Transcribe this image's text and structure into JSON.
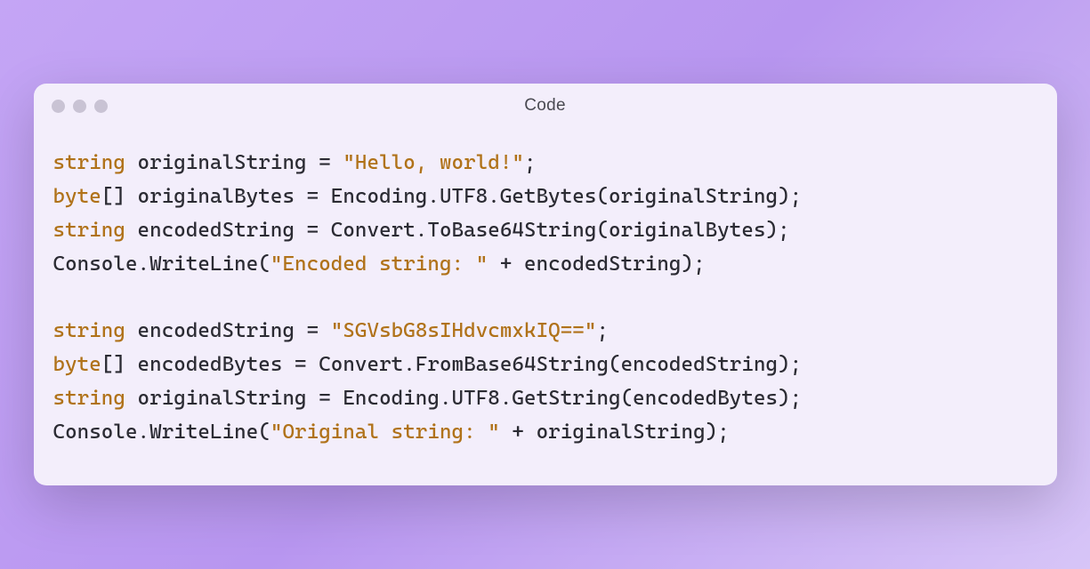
{
  "window": {
    "title": "Code"
  },
  "code": {
    "lines": [
      [
        {
          "cls": "tok-keyword",
          "text": "string"
        },
        {
          "cls": "tok-plain",
          "text": " originalString = "
        },
        {
          "cls": "tok-string",
          "text": "\"Hello, world!\""
        },
        {
          "cls": "tok-plain",
          "text": ";"
        }
      ],
      [
        {
          "cls": "tok-keyword",
          "text": "byte"
        },
        {
          "cls": "tok-plain",
          "text": "[] originalBytes = Encoding.UTF8.GetBytes(originalString);"
        }
      ],
      [
        {
          "cls": "tok-keyword",
          "text": "string"
        },
        {
          "cls": "tok-plain",
          "text": " encodedString = Convert.ToBase64String(originalBytes);"
        }
      ],
      [
        {
          "cls": "tok-plain",
          "text": "Console.WriteLine("
        },
        {
          "cls": "tok-string",
          "text": "\"Encoded string: \""
        },
        {
          "cls": "tok-plain",
          "text": " + encodedString);"
        }
      ],
      [
        {
          "cls": "tok-plain",
          "text": ""
        }
      ],
      [
        {
          "cls": "tok-keyword",
          "text": "string"
        },
        {
          "cls": "tok-plain",
          "text": " encodedString = "
        },
        {
          "cls": "tok-string",
          "text": "\"SGVsbG8sIHdvcmxkIQ==\""
        },
        {
          "cls": "tok-plain",
          "text": ";"
        }
      ],
      [
        {
          "cls": "tok-keyword",
          "text": "byte"
        },
        {
          "cls": "tok-plain",
          "text": "[] encodedBytes = Convert.FromBase64String(encodedString);"
        }
      ],
      [
        {
          "cls": "tok-keyword",
          "text": "string"
        },
        {
          "cls": "tok-plain",
          "text": " originalString = Encoding.UTF8.GetString(encodedBytes);"
        }
      ],
      [
        {
          "cls": "tok-plain",
          "text": "Console.WriteLine("
        },
        {
          "cls": "tok-string",
          "text": "\"Original string: \""
        },
        {
          "cls": "tok-plain",
          "text": " + originalString);"
        }
      ]
    ]
  }
}
